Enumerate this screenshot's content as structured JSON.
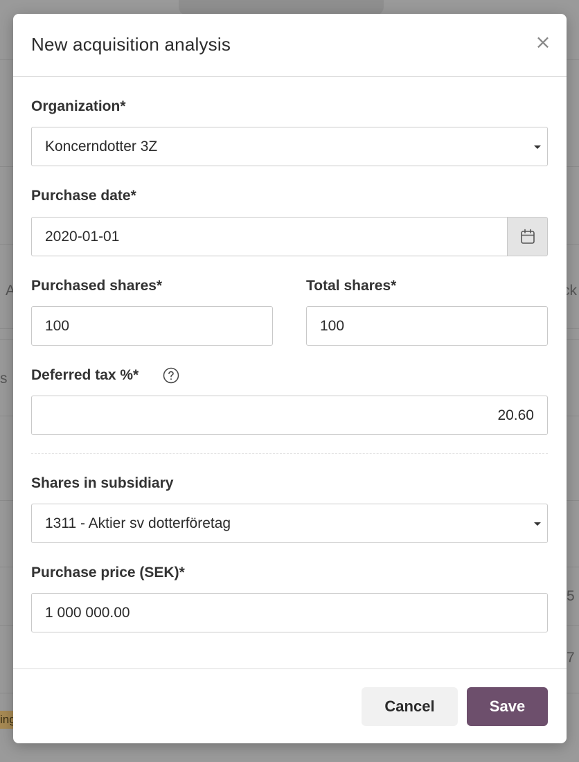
{
  "dialog": {
    "title": "New acquisition analysis",
    "close_symbol": "×"
  },
  "form": {
    "organization": {
      "label": "Organization*",
      "value": "Koncerndotter 3Z"
    },
    "purchase_date": {
      "label": "Purchase date*",
      "value": "2020-01-01",
      "icon": "calendar-icon"
    },
    "purchased_shares": {
      "label": "Purchased shares*",
      "value": "100"
    },
    "total_shares": {
      "label": "Total shares*",
      "value": "100"
    },
    "deferred_tax": {
      "label": "Deferred tax %*",
      "value": "20.60",
      "icon": "help-circle-icon"
    },
    "shares_in_subsidiary": {
      "label": "Shares in subsidiary",
      "value": "1311 - Aktier sv dotterföretag"
    },
    "purchase_price": {
      "label": "Purchase price (SEK)*",
      "value": "1 000 000.00"
    }
  },
  "footer": {
    "cancel_label": "Cancel",
    "save_label": "Save"
  },
  "background": {
    "fragments": [
      "A",
      "ck",
      "s",
      "5",
      "7",
      "ing"
    ]
  },
  "colors": {
    "primary": "#6d4f6c",
    "overlay": "#9a9a9a",
    "border": "#c9c9c9"
  }
}
